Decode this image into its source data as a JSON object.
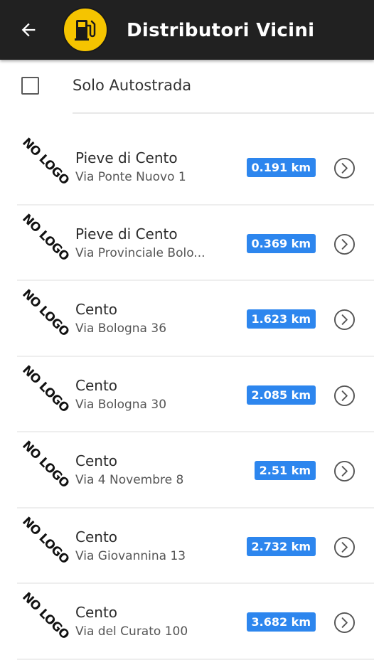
{
  "header": {
    "title": "Distributori Vicini",
    "back_icon": "arrow-left-icon",
    "logo_icon": "fuel-pump-icon"
  },
  "filter": {
    "checkbox_label": "Solo Autostrada",
    "checked": false
  },
  "colors": {
    "appbar": "#212121",
    "logo_bg": "#f5c400",
    "distance_badge": "#2d86ee"
  },
  "stations": [
    {
      "logo_text": "NO LOGO",
      "name": "Pieve di Cento",
      "address": "Via Ponte Nuovo 1",
      "distance": "0.191 km"
    },
    {
      "logo_text": "NO LOGO",
      "name": "Pieve di Cento",
      "address": "Via Provinciale Bolo...",
      "distance": "0.369 km"
    },
    {
      "logo_text": "NO LOGO",
      "name": "Cento",
      "address": "Via Bologna 36",
      "distance": "1.623 km"
    },
    {
      "logo_text": "NO LOGO",
      "name": "Cento",
      "address": "Via Bologna 30",
      "distance": "2.085 km"
    },
    {
      "logo_text": "NO LOGO",
      "name": "Cento",
      "address": "Via 4 Novembre 8",
      "distance": "2.51 km"
    },
    {
      "logo_text": "NO LOGO",
      "name": "Cento",
      "address": "Via Giovannina 13",
      "distance": "2.732 km"
    },
    {
      "logo_text": "NO LOGO",
      "name": "Cento",
      "address": "Via del Curato 100",
      "distance": "3.682 km"
    }
  ]
}
